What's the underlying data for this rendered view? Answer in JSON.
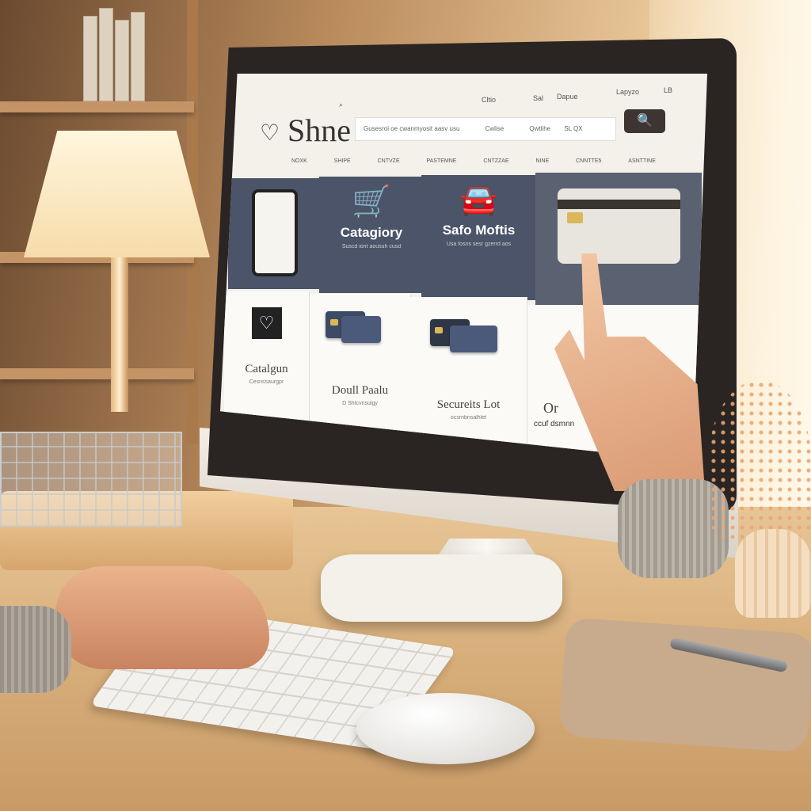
{
  "scene": {
    "accent_dark": "#4b5468",
    "screen_bg": "#f4f1ea"
  },
  "website": {
    "logo": "Shne",
    "top_links": [
      "Cltio",
      "Sal",
      "Dapue",
      "Lapyzo",
      "LB"
    ],
    "search_placeholder": "Gusesroi oe cwanmyosit aasv usu",
    "search_extras": [
      "Cwlise",
      "Qwtlihe",
      "SL QX"
    ],
    "search_icon": "magnifier-icon",
    "nav": [
      "NOXK",
      "SHIPE",
      "CNTVZE",
      "PASTEMNE",
      "CNTZZAE",
      "NINE",
      "CNNTTE5",
      "ASNTTINE"
    ],
    "top_tiles": [
      {
        "icon": "tablet-icon",
        "title": "",
        "sub": ""
      },
      {
        "icon": "cart-icon",
        "title": "Catagiory",
        "sub": "Suscd iont aousuh cusd"
      },
      {
        "icon": "car-icon",
        "title": "Safo Moftis",
        "sub": "Usa fosns sesr gzerrd aos"
      },
      {
        "icon": "credit-card-icon",
        "title": "",
        "sub": ""
      }
    ],
    "bottom_tiles": [
      {
        "icon": "shopping-bag-icon",
        "title": "Catalgun",
        "sub": "Cesnssaurgpr"
      },
      {
        "icon": "cards-icon",
        "title": "Doull Paalu",
        "sub": "D Shtcvnsulgy"
      },
      {
        "icon": "cards-icon",
        "title": "Secureits Lot",
        "sub": "ocsrnbnsalhlet"
      },
      {
        "icon": "",
        "title": "Or",
        "sub": "ccuf dsmnn"
      }
    ]
  }
}
